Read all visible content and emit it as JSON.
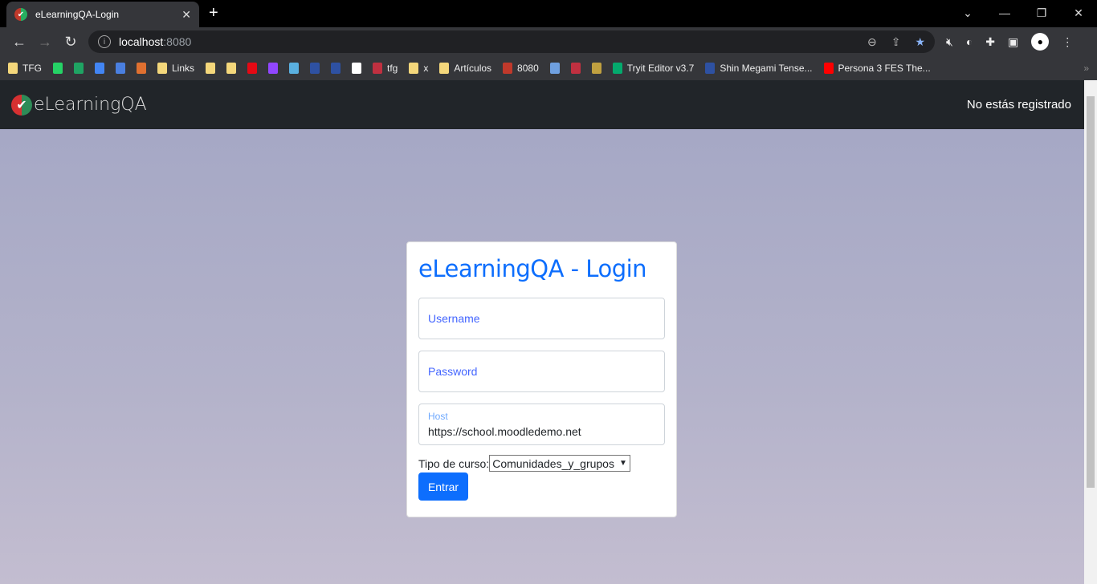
{
  "browser": {
    "tab_title": "eLearningQA-Login",
    "url_host": "localhost",
    "url_port": ":8080",
    "bookmarks": [
      {
        "label": "TFG",
        "color": "#f4d77b"
      },
      {
        "label": "",
        "color": "#25d366"
      },
      {
        "label": "",
        "color": "#1fa463"
      },
      {
        "label": "",
        "color": "#4285f4"
      },
      {
        "label": "",
        "color": "#4a7fe0"
      },
      {
        "label": "",
        "color": "#e07030"
      },
      {
        "label": "Links",
        "color": "#f4d77b"
      },
      {
        "label": "",
        "color": "#f4d77b"
      },
      {
        "label": "",
        "color": "#f4d77b"
      },
      {
        "label": "",
        "color": "#e50914"
      },
      {
        "label": "",
        "color": "#9146ff"
      },
      {
        "label": "",
        "color": "#5ab0e0"
      },
      {
        "label": "",
        "color": "#2e51a2"
      },
      {
        "label": "",
        "color": "#2e51a2"
      },
      {
        "label": "",
        "color": "#ffffff"
      },
      {
        "label": "tfg",
        "color": "#c03040"
      },
      {
        "label": "x",
        "color": "#f4d77b"
      },
      {
        "label": "Artículos",
        "color": "#f4d77b"
      },
      {
        "label": "8080",
        "color": "#c0392b"
      },
      {
        "label": "",
        "color": "#6fa0e0"
      },
      {
        "label": "",
        "color": "#c03040"
      },
      {
        "label": "",
        "color": "#c0a040"
      },
      {
        "label": "Tryit Editor v3.7",
        "color": "#04aa6d"
      },
      {
        "label": "Shin Megami Tense...",
        "color": "#2e51a2"
      },
      {
        "label": "Persona 3 FES The...",
        "color": "#ff0000"
      }
    ]
  },
  "navbar": {
    "brand": "eLearningQA",
    "status": "No estás registrado"
  },
  "login": {
    "title": "eLearningQA - Login",
    "username_placeholder": "Username",
    "password_placeholder": "Password",
    "host_label": "Host",
    "host_value": "https://school.moodledemo.net",
    "course_type_label": "Tipo de curso:",
    "course_type_selected": "Comunidades_y_grupos",
    "submit": "Entrar"
  }
}
